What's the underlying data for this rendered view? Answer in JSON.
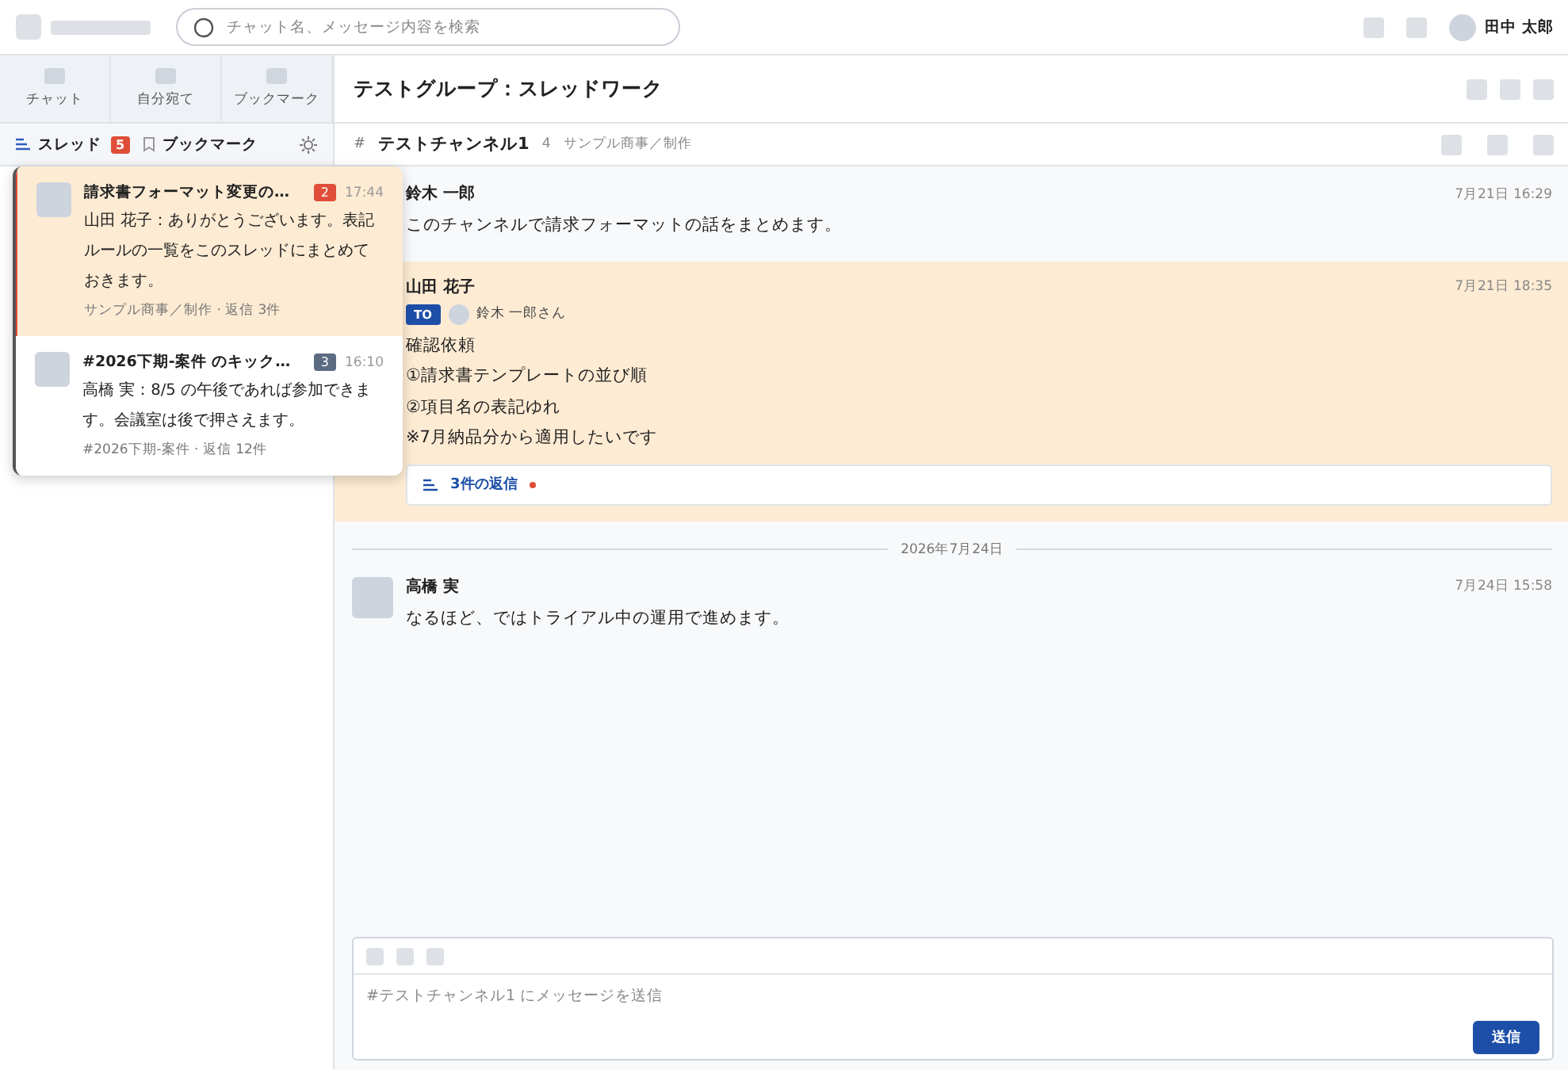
{
  "topbar": {
    "search": {
      "placeholder": "チャット名、メッセージ内容を検索"
    },
    "user": {
      "name": "田中 太郎"
    }
  },
  "nav_tabs": [
    {
      "label": "チャット",
      "selected": false
    },
    {
      "label": "自分宛て",
      "selected": false
    },
    {
      "label": "ブックマーク",
      "selected": false
    }
  ],
  "sub_tabs": [
    {
      "kind": "thread",
      "label": "スレッド",
      "badge": "5",
      "selected": true
    },
    {
      "kind": "bookmark",
      "label": "ブックマーク",
      "selected": false
    }
  ],
  "thread_popup": [
    {
      "title": "請求書フォーマット変更の…",
      "badge": "2",
      "color": "#e04e39",
      "time": "17:44",
      "preview": "山田 花子：ありがとうございます。表記ルールの一覧をこのスレッドにまとめておきます。",
      "meta": "サンプル商事／制作 · 返信 3件",
      "selected": true
    },
    {
      "title": "#2026下期-案件 のキック…",
      "badge": "3",
      "color": "#5d6b82",
      "time": "16:10",
      "preview": "高橋 実：8/5 の午後であれば参加できます。会議室は後で押さえます。",
      "meta": "#2026下期-案件 · 返信 12件",
      "selected": false
    }
  ],
  "header": {
    "title": "テストグループ：スレッドワーク"
  },
  "channel": {
    "hash": "#",
    "name": "テストチャンネル1",
    "count": "4",
    "org": "サンプル商事／制作"
  },
  "messages": [
    {
      "kind": "message",
      "author": "鈴木 一郎",
      "time": "7月21日 16:29",
      "highlighted": false,
      "lines": [
        "このチャンネルで請求フォーマットの話をまとめます。"
      ]
    },
    {
      "kind": "message",
      "author": "山田 花子",
      "time": "7月21日 18:35",
      "highlighted": true,
      "to": {
        "tag": "TO",
        "name": "鈴木 一郎さん"
      },
      "lines": [
        "確認依頼",
        "①請求書テンプレートの並び順",
        "②項目名の表記ゆれ",
        "※7月納品分から適用したいです"
      ],
      "replies": {
        "label": "3件の返信",
        "unread": true
      }
    },
    {
      "kind": "date",
      "label": "2026年7月24日"
    },
    {
      "kind": "message",
      "author": "高橋 実",
      "time": "7月24日 15:58",
      "highlighted": false,
      "lines": [
        "なるほど、ではトライアル中の運用で進めます。"
      ]
    }
  ],
  "composer": {
    "placeholder": "#テストチャンネル1 にメッセージを送信",
    "send": "送信"
  }
}
